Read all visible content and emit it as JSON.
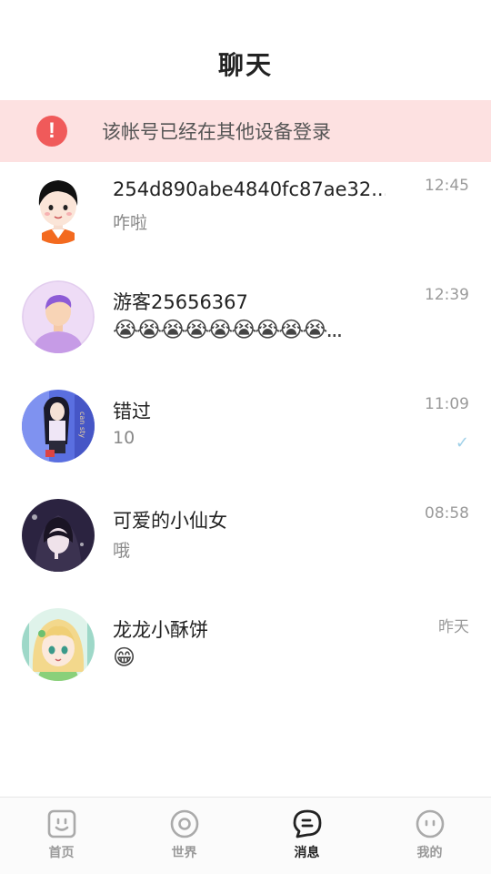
{
  "header": {
    "title": "聊天"
  },
  "warning": {
    "text": "该帐号已经在其他设备登录",
    "icon": "alert-icon",
    "icon_glyph": "!"
  },
  "chats": [
    {
      "name": "254d890abe4840fc87ae32...",
      "time": "12:45",
      "preview": "咋啦",
      "avatar": "boy-avatar"
    },
    {
      "name": "游客25656367",
      "time": "12:39",
      "preview": "😭😭😭😭😭😭😭😭😭...",
      "avatar": "guest-avatar"
    },
    {
      "name": "错过",
      "time": "11:09",
      "preview": "10",
      "avatar": "anime-girl-avatar",
      "read_mark": "✓"
    },
    {
      "name": "可爱的小仙女",
      "time": "08:58",
      "preview": "哦",
      "avatar": "hooded-boy-avatar"
    },
    {
      "name": "龙龙小酥饼",
      "time": "昨天",
      "preview": "😁",
      "avatar": "blonde-girl-avatar"
    }
  ],
  "tabbar": {
    "active": "messages",
    "tabs": [
      {
        "label": "首页",
        "icon": "home-face-icon"
      },
      {
        "label": "世界",
        "icon": "world-ring-icon"
      },
      {
        "label": "消息",
        "icon": "message-bubble-icon"
      },
      {
        "label": "我的",
        "icon": "profile-face-icon"
      }
    ]
  }
}
